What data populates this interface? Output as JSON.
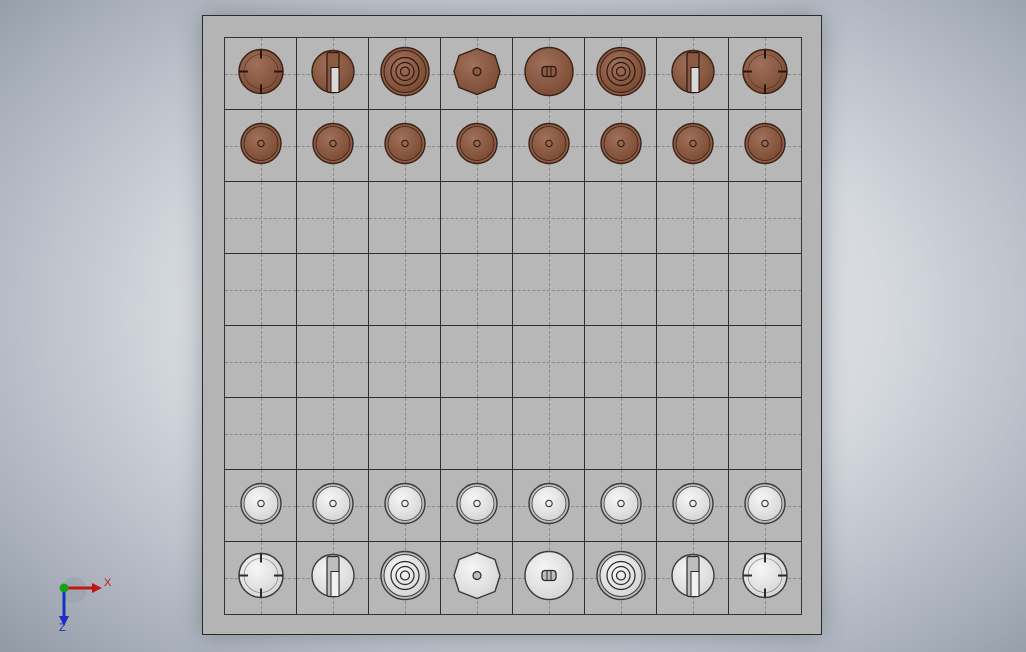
{
  "window": {
    "title": ""
  },
  "board": {
    "files": 8,
    "ranks": 8,
    "colors": {
      "board": "#b4b4b4",
      "dark_piece": "#7a4a33",
      "light_piece": "#d4d4d4"
    },
    "rows": [
      [
        "dark-rook",
        "dark-knight",
        "dark-bishop",
        "dark-queen",
        "dark-king",
        "dark-bishop",
        "dark-knight",
        "dark-rook"
      ],
      [
        "dark-pawn",
        "dark-pawn",
        "dark-pawn",
        "dark-pawn",
        "dark-pawn",
        "dark-pawn",
        "dark-pawn",
        "dark-pawn"
      ],
      [
        "",
        "",
        "",
        "",
        "",
        "",
        "",
        ""
      ],
      [
        "",
        "",
        "",
        "",
        "",
        "",
        "",
        ""
      ],
      [
        "",
        "",
        "",
        "",
        "",
        "",
        "",
        ""
      ],
      [
        "",
        "",
        "",
        "",
        "",
        "",
        "",
        ""
      ],
      [
        "light-pawn",
        "light-pawn",
        "light-pawn",
        "light-pawn",
        "light-pawn",
        "light-pawn",
        "light-pawn",
        "light-pawn"
      ],
      [
        "light-rook",
        "light-knight",
        "light-bishop",
        "light-queen",
        "light-king",
        "light-bishop",
        "light-knight",
        "light-rook"
      ]
    ]
  },
  "triad": {
    "x_label": "X",
    "z_label": "Z",
    "colors": {
      "x": "#c01818",
      "y": "#18a018",
      "z": "#1830c0"
    }
  }
}
